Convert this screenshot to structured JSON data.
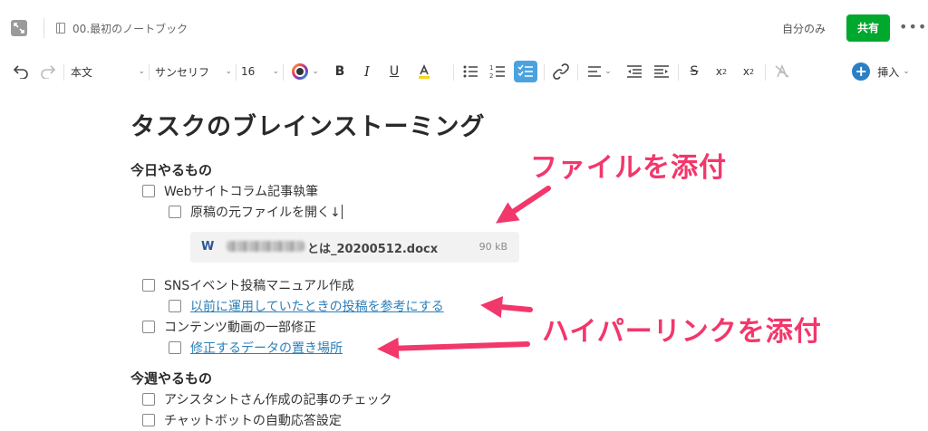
{
  "header": {
    "notebook_title": "00.最初のノートブック",
    "visibility": "自分のみ",
    "share_label": "共有",
    "more_label": "•••"
  },
  "toolbar": {
    "paragraph_style": "本文",
    "font_family": "サンセリフ",
    "font_size": "16",
    "insert_label": "挿入",
    "icons": [
      "undo-icon",
      "redo-icon",
      "text-color-icon",
      "bold-icon",
      "italic-icon",
      "underline-icon",
      "highlight-icon",
      "bulleted-list-icon",
      "numbered-list-icon",
      "checklist-icon",
      "link-icon",
      "align-icon",
      "outdent-icon",
      "indent-icon",
      "strikethrough-icon",
      "superscript-icon",
      "subscript-icon",
      "clear-format-icon",
      "plus-icon"
    ],
    "active_icon": "checklist-icon",
    "accent_color": "#4aa3df"
  },
  "note": {
    "title": "タスクのブレインストーミング",
    "section_today": "今日やるもの",
    "section_week": "今週やるもの",
    "tasks": {
      "t1": "Webサイトコラム記事執筆",
      "t1a": "原稿の元ファイルを開く↓",
      "t2": "SNSイベント投稿マニュアル作成",
      "t2a": "以前に運用していたときの投稿を参考にする",
      "t3": "コンテンツ動画の一部修正",
      "t3a": "修正するデータの置き場所",
      "w1": "アシスタントさん作成の記事のチェック",
      "w2": "チャットボットの自動応答設定"
    },
    "attachment": {
      "icon": "word-doc-icon",
      "file_name": "とは_20200512.docx",
      "file_size": "90 kB"
    }
  },
  "annotations": {
    "file": "ファイルを添付",
    "hyperlink": "ハイパーリンクを添付",
    "color": "#f2376b"
  },
  "colors": {
    "share_button": "#00a82d",
    "link": "#2c7fb8",
    "insert_button": "#2c7fc4"
  }
}
